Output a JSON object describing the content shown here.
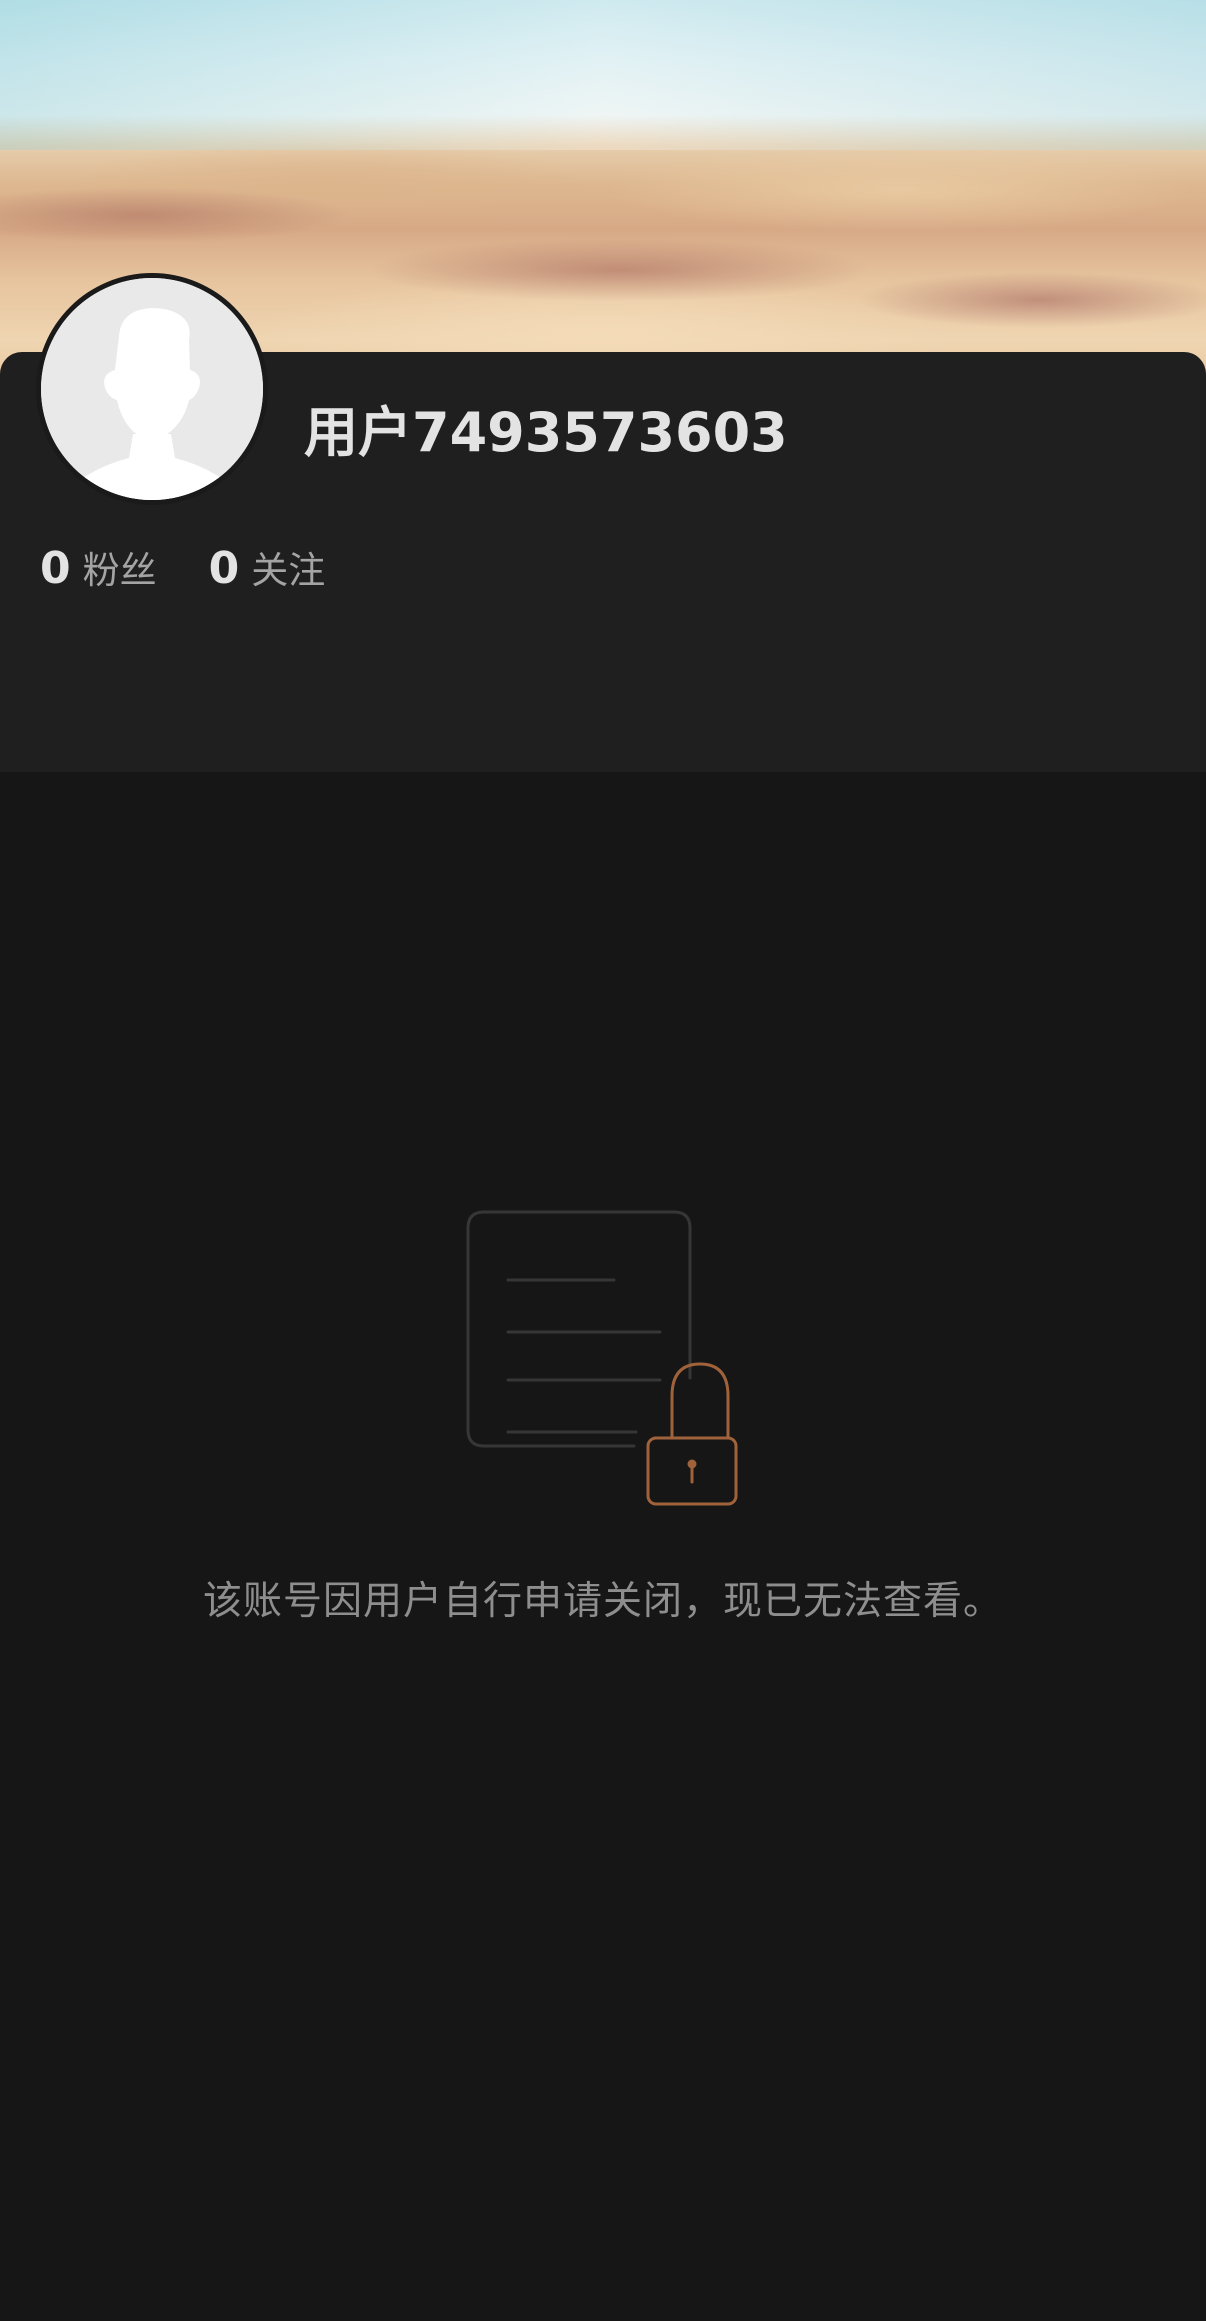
{
  "profile": {
    "username": "用户7493573603",
    "stats": [
      {
        "count": "0",
        "label": "粉丝"
      },
      {
        "count": "0",
        "label": "关注"
      }
    ]
  },
  "notice": {
    "message": "该账号因用户自行申请关闭，现已无法查看。",
    "icon": "locked-document-icon"
  },
  "colors": {
    "background": "#161616",
    "card": "#1f1f1f",
    "lock_accent": "#a0623a"
  }
}
